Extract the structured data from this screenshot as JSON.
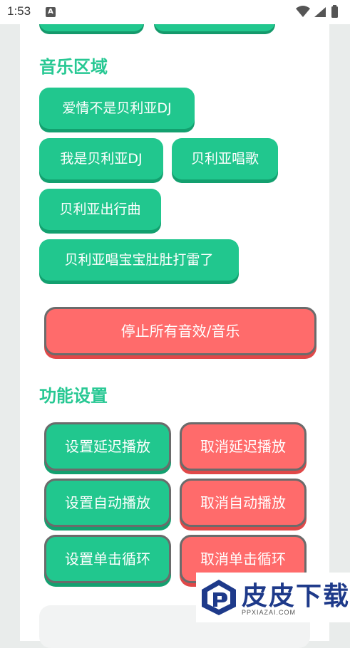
{
  "status_bar": {
    "time": "1:53",
    "notification_icon": "A"
  },
  "sections": {
    "music_title": "音乐区域",
    "settings_title": "功能设置"
  },
  "music_buttons": [
    "爱情不是贝利亚DJ",
    "我是贝利亚DJ",
    "贝利亚唱歌",
    "贝利亚出行曲",
    "贝利亚唱宝宝肚肚打雷了"
  ],
  "stop_button": "停止所有音效/音乐",
  "settings_buttons": {
    "set_delay": "设置延迟播放",
    "cancel_delay": "取消延迟播放",
    "set_auto": "设置自动播放",
    "cancel_auto": "取消自动播放",
    "set_loop": "设置单击循环",
    "cancel_loop": "取消单击循环"
  },
  "watermark": {
    "brand": "皮皮下载",
    "url": "PPXIAZAI.COM"
  },
  "colors": {
    "green": "#21c78e",
    "red": "#ff6b6b",
    "title": "#27c893"
  }
}
